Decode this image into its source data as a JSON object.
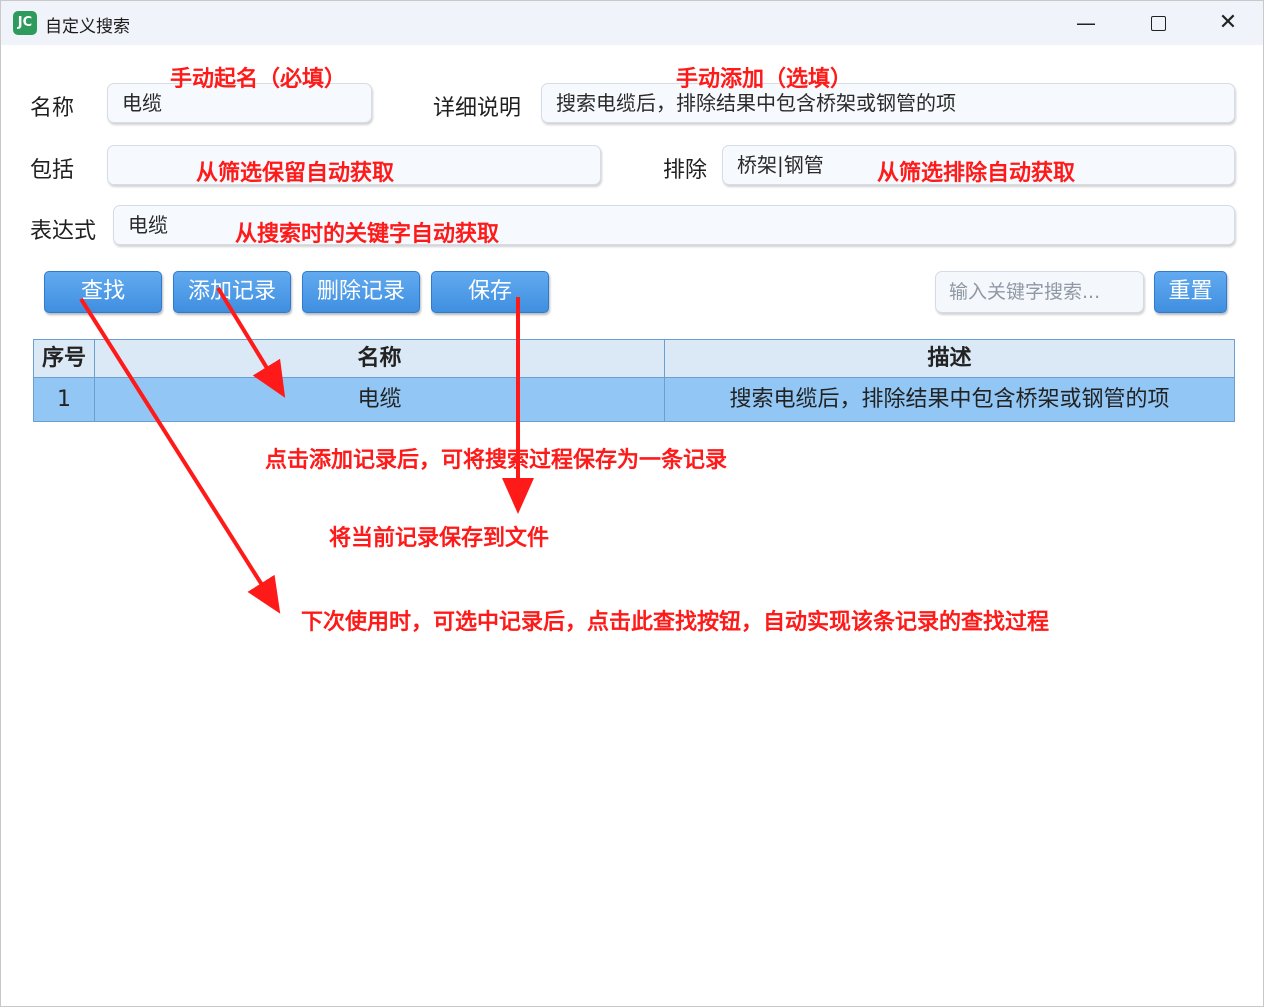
{
  "window": {
    "title": "自定义搜索",
    "app_icon_text": "JC",
    "min_glyph": "—",
    "close_glyph": "✕"
  },
  "form": {
    "name_label": "名称",
    "name_value": "电缆",
    "detail_label": "详细说明",
    "detail_value": "搜索电缆后，排除结果中包含桥架或钢管的项",
    "include_label": "包括",
    "include_value": "",
    "exclude_label": "排除",
    "exclude_value": "桥架|钢管",
    "expr_label": "表达式",
    "expr_value": "电缆"
  },
  "toolbar": {
    "find": "查找",
    "add_record": "添加记录",
    "delete_record": "删除记录",
    "save": "保存",
    "search_placeholder": "输入关键字搜索...",
    "reset": "重置"
  },
  "table": {
    "columns": [
      "序号",
      "名称",
      "描述"
    ],
    "rows": [
      {
        "index": "1",
        "name": "电缆",
        "desc": "搜索电缆后，排除结果中包含桥架或钢管的项"
      }
    ]
  },
  "annotations": {
    "name_hint": "手动起名（必填）",
    "detail_hint": "手动添加（选填）",
    "include_hint": "从筛选保留自动获取",
    "exclude_hint": "从筛选排除自动获取",
    "expr_hint": "从搜索时的关键字自动获取",
    "add_hint": "点击添加记录后，可将搜索过程保存为一条记录",
    "save_hint": "将当前记录保存到文件",
    "find_hint": "下次使用时，可选中记录后，点击此查找按钮，自动实现该条记录的查找过程",
    "color": "#ff1a1a"
  },
  "colors": {
    "button_blue": "#3f8fe0",
    "selected_row": "#92c6f5",
    "header_bg": "#dbe9f6"
  }
}
